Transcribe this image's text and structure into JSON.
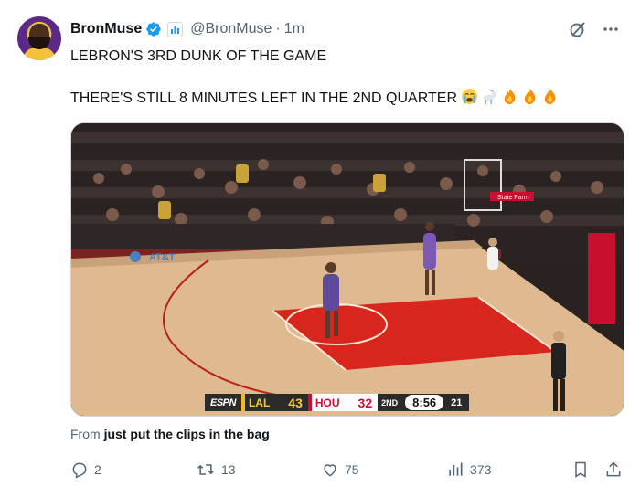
{
  "author": {
    "name": "BronMuse",
    "handle": "@BronMuse",
    "separator": "·",
    "time": "1m"
  },
  "tweet": {
    "line1": "LEBRON'S 3RD DUNK OF THE GAME",
    "line2": "THERE'S STILL 8 MINUTES LEFT IN THE 2ND QUARTER",
    "emojis": [
      "loudly-crying-face",
      "goat",
      "fire",
      "fire",
      "fire"
    ]
  },
  "scoreboard": {
    "network": "ESPN",
    "away_team": "LAL",
    "away_score": "43",
    "home_team": "HOU",
    "home_score": "32",
    "quarter": "2ND",
    "clock": "8:56",
    "shot_clock": "21"
  },
  "video_overlay": {
    "court_text": "AT&T",
    "sponsor_text": "State Farm"
  },
  "source": {
    "prefix": "From",
    "name": "just put the clips in the bag"
  },
  "actions": {
    "replies": "2",
    "reposts": "13",
    "likes": "75",
    "views": "373"
  },
  "colors": {
    "text": "#0f1419",
    "muted": "#536471",
    "verified": "#1d9bf0",
    "court_paint": "#d8261c",
    "lakers_gold": "#f1b825",
    "rockets_red": "#c8102e"
  }
}
